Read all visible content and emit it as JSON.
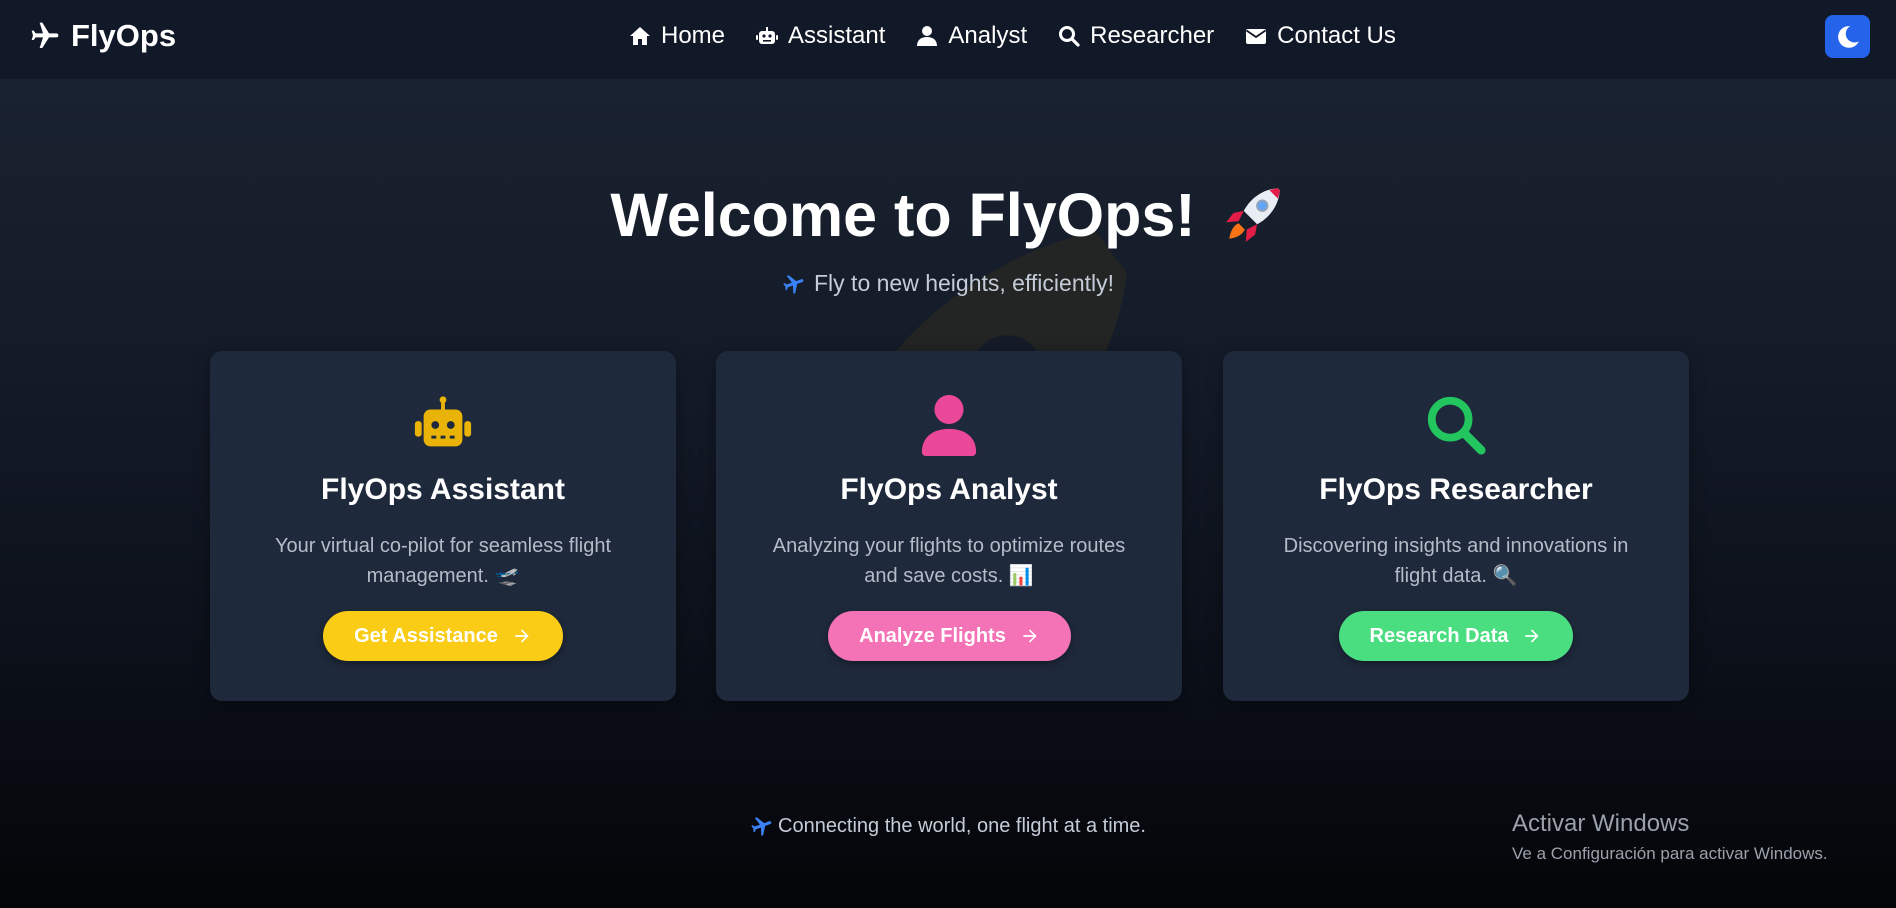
{
  "navbar": {
    "brand": "FlyOps",
    "links": [
      {
        "label": "Home",
        "icon": "home-icon"
      },
      {
        "label": "Assistant",
        "icon": "robot-icon"
      },
      {
        "label": "Analyst",
        "icon": "user-icon"
      },
      {
        "label": "Researcher",
        "icon": "search-icon"
      },
      {
        "label": "Contact Us",
        "icon": "envelope-icon"
      }
    ],
    "theme_toggle_icon": "moon-icon"
  },
  "hero": {
    "title": "Welcome to FlyOps!",
    "title_emoji": "rocket-icon",
    "subtitle": "Fly to new heights, efficiently!"
  },
  "cards": [
    {
      "icon": "robot-icon",
      "icon_color": "#eab308",
      "title": "FlyOps Assistant",
      "description": "Your virtual co-pilot for seamless flight management. 🛫",
      "button_label": "Get Assistance",
      "button_color": "#facc15"
    },
    {
      "icon": "user-icon",
      "icon_color": "#ec4899",
      "title": "FlyOps Analyst",
      "description": "Analyzing your flights to optimize routes and save costs. 📊",
      "button_label": "Analyze Flights",
      "button_color": "#f472b6"
    },
    {
      "icon": "search-icon",
      "icon_color": "#22c55e",
      "title": "FlyOps Researcher",
      "description": "Discovering insights and innovations in flight data. 🔍",
      "button_label": "Research Data",
      "button_color": "#4ade80"
    }
  ],
  "footer": {
    "text": "Connecting the world, one flight at a time."
  },
  "os_watermark": {
    "title": "Activar Windows",
    "subtitle": "Ve a Configuración para activar Windows."
  },
  "colors": {
    "navbar_bg": "#111827",
    "card_bg": "#1e293b",
    "accent_blue": "#2563eb"
  }
}
